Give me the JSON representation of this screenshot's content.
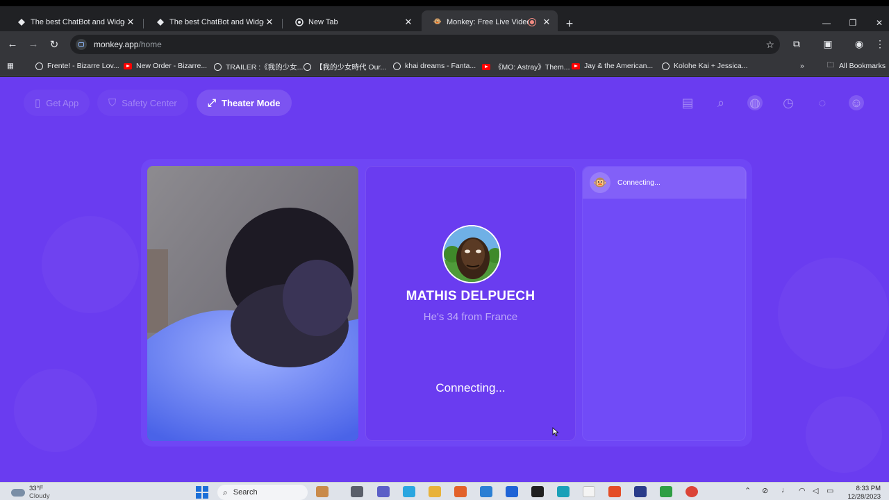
{
  "browser": {
    "tabs": [
      {
        "title": "The best ChatBot and Widgets",
        "active": false
      },
      {
        "title": "The best ChatBot and Widgets",
        "active": false
      },
      {
        "title": "New Tab",
        "active": false
      },
      {
        "title": "Monkey: Free Live Video Ch",
        "active": true
      }
    ],
    "url_host": "monkey.app",
    "url_path": "/home",
    "bookmarks": [
      {
        "label": "Frente! - Bizarre Lov...",
        "icon": "globe-icon"
      },
      {
        "label": "New Order - Bizarre...",
        "icon": "youtube-icon"
      },
      {
        "label": "TRAILER :《我的少女...",
        "icon": "globe-icon"
      },
      {
        "label": "【我的少女時代 Our...",
        "icon": "globe-icon"
      },
      {
        "label": "khai dreams - Fanta...",
        "icon": "globe-icon"
      },
      {
        "label": "《MO: Astray》Them...",
        "icon": "youtube-icon"
      },
      {
        "label": "Jay & the American...",
        "icon": "youtube-icon"
      },
      {
        "label": "Kolohe Kai + Jessica...",
        "icon": "globe-icon"
      }
    ],
    "all_bookmarks": "All Bookmarks"
  },
  "nav": {
    "get_app": "Get App",
    "safety_center": "Safety Center",
    "theater_mode": "Theater Mode"
  },
  "partner": {
    "name": "MATHIS DELPUECH",
    "info": "He's 34 from France",
    "status": "Connecting..."
  },
  "chat": {
    "message": "Connecting..."
  },
  "taskbar": {
    "temperature": "33°F",
    "condition": "Cloudy",
    "search_placeholder": "Search",
    "time": "8:33 PM",
    "date": "12/28/2023"
  },
  "colors": {
    "page_bg": "#6a3cf0",
    "chrome_dark": "#202124",
    "chrome_toolbar": "#35363a"
  }
}
